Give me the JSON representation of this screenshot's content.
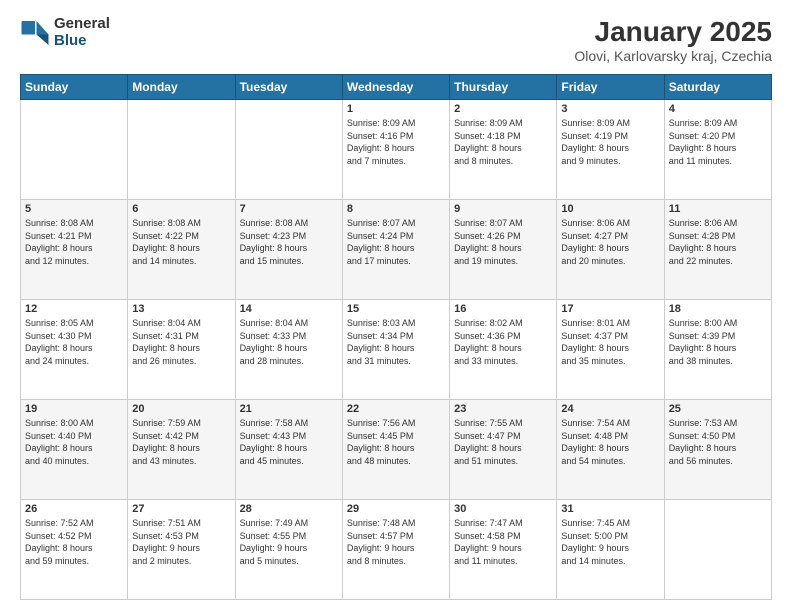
{
  "header": {
    "logo_general": "General",
    "logo_blue": "Blue",
    "month_title": "January 2025",
    "location": "Olovi, Karlovarsky kraj, Czechia"
  },
  "weekdays": [
    "Sunday",
    "Monday",
    "Tuesday",
    "Wednesday",
    "Thursday",
    "Friday",
    "Saturday"
  ],
  "weeks": [
    [
      {
        "day": "",
        "info": ""
      },
      {
        "day": "",
        "info": ""
      },
      {
        "day": "",
        "info": ""
      },
      {
        "day": "1",
        "info": "Sunrise: 8:09 AM\nSunset: 4:16 PM\nDaylight: 8 hours\nand 7 minutes."
      },
      {
        "day": "2",
        "info": "Sunrise: 8:09 AM\nSunset: 4:18 PM\nDaylight: 8 hours\nand 8 minutes."
      },
      {
        "day": "3",
        "info": "Sunrise: 8:09 AM\nSunset: 4:19 PM\nDaylight: 8 hours\nand 9 minutes."
      },
      {
        "day": "4",
        "info": "Sunrise: 8:09 AM\nSunset: 4:20 PM\nDaylight: 8 hours\nand 11 minutes."
      }
    ],
    [
      {
        "day": "5",
        "info": "Sunrise: 8:08 AM\nSunset: 4:21 PM\nDaylight: 8 hours\nand 12 minutes."
      },
      {
        "day": "6",
        "info": "Sunrise: 8:08 AM\nSunset: 4:22 PM\nDaylight: 8 hours\nand 14 minutes."
      },
      {
        "day": "7",
        "info": "Sunrise: 8:08 AM\nSunset: 4:23 PM\nDaylight: 8 hours\nand 15 minutes."
      },
      {
        "day": "8",
        "info": "Sunrise: 8:07 AM\nSunset: 4:24 PM\nDaylight: 8 hours\nand 17 minutes."
      },
      {
        "day": "9",
        "info": "Sunrise: 8:07 AM\nSunset: 4:26 PM\nDaylight: 8 hours\nand 19 minutes."
      },
      {
        "day": "10",
        "info": "Sunrise: 8:06 AM\nSunset: 4:27 PM\nDaylight: 8 hours\nand 20 minutes."
      },
      {
        "day": "11",
        "info": "Sunrise: 8:06 AM\nSunset: 4:28 PM\nDaylight: 8 hours\nand 22 minutes."
      }
    ],
    [
      {
        "day": "12",
        "info": "Sunrise: 8:05 AM\nSunset: 4:30 PM\nDaylight: 8 hours\nand 24 minutes."
      },
      {
        "day": "13",
        "info": "Sunrise: 8:04 AM\nSunset: 4:31 PM\nDaylight: 8 hours\nand 26 minutes."
      },
      {
        "day": "14",
        "info": "Sunrise: 8:04 AM\nSunset: 4:33 PM\nDaylight: 8 hours\nand 28 minutes."
      },
      {
        "day": "15",
        "info": "Sunrise: 8:03 AM\nSunset: 4:34 PM\nDaylight: 8 hours\nand 31 minutes."
      },
      {
        "day": "16",
        "info": "Sunrise: 8:02 AM\nSunset: 4:36 PM\nDaylight: 8 hours\nand 33 minutes."
      },
      {
        "day": "17",
        "info": "Sunrise: 8:01 AM\nSunset: 4:37 PM\nDaylight: 8 hours\nand 35 minutes."
      },
      {
        "day": "18",
        "info": "Sunrise: 8:00 AM\nSunset: 4:39 PM\nDaylight: 8 hours\nand 38 minutes."
      }
    ],
    [
      {
        "day": "19",
        "info": "Sunrise: 8:00 AM\nSunset: 4:40 PM\nDaylight: 8 hours\nand 40 minutes."
      },
      {
        "day": "20",
        "info": "Sunrise: 7:59 AM\nSunset: 4:42 PM\nDaylight: 8 hours\nand 43 minutes."
      },
      {
        "day": "21",
        "info": "Sunrise: 7:58 AM\nSunset: 4:43 PM\nDaylight: 8 hours\nand 45 minutes."
      },
      {
        "day": "22",
        "info": "Sunrise: 7:56 AM\nSunset: 4:45 PM\nDaylight: 8 hours\nand 48 minutes."
      },
      {
        "day": "23",
        "info": "Sunrise: 7:55 AM\nSunset: 4:47 PM\nDaylight: 8 hours\nand 51 minutes."
      },
      {
        "day": "24",
        "info": "Sunrise: 7:54 AM\nSunset: 4:48 PM\nDaylight: 8 hours\nand 54 minutes."
      },
      {
        "day": "25",
        "info": "Sunrise: 7:53 AM\nSunset: 4:50 PM\nDaylight: 8 hours\nand 56 minutes."
      }
    ],
    [
      {
        "day": "26",
        "info": "Sunrise: 7:52 AM\nSunset: 4:52 PM\nDaylight: 8 hours\nand 59 minutes."
      },
      {
        "day": "27",
        "info": "Sunrise: 7:51 AM\nSunset: 4:53 PM\nDaylight: 9 hours\nand 2 minutes."
      },
      {
        "day": "28",
        "info": "Sunrise: 7:49 AM\nSunset: 4:55 PM\nDaylight: 9 hours\nand 5 minutes."
      },
      {
        "day": "29",
        "info": "Sunrise: 7:48 AM\nSunset: 4:57 PM\nDaylight: 9 hours\nand 8 minutes."
      },
      {
        "day": "30",
        "info": "Sunrise: 7:47 AM\nSunset: 4:58 PM\nDaylight: 9 hours\nand 11 minutes."
      },
      {
        "day": "31",
        "info": "Sunrise: 7:45 AM\nSunset: 5:00 PM\nDaylight: 9 hours\nand 14 minutes."
      },
      {
        "day": "",
        "info": ""
      }
    ]
  ]
}
